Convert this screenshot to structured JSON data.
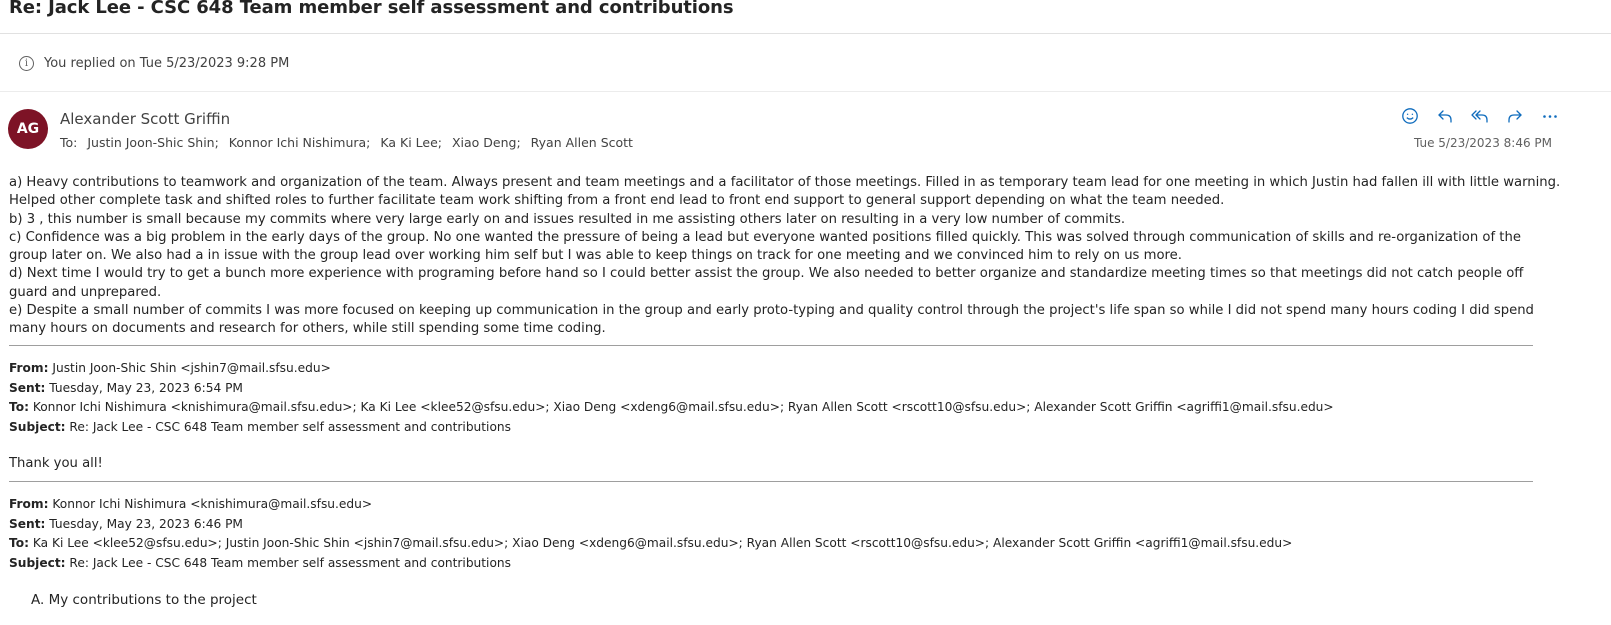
{
  "subject": "Re: Jack Lee - CSC 648 Team member self assessment and contributions",
  "info": {
    "icon": "info-icon",
    "text": "You replied on Tue 5/23/2023 9:28 PM"
  },
  "message": {
    "avatar_initials": "AG",
    "avatar_color": "#7d1326",
    "sender": "Alexander Scott Griffin",
    "to_label": "To:",
    "recipients": [
      "Justin Joon-Shic Shin;",
      "Konnor Ichi Nishimura;",
      "Ka Ki Lee;",
      "Xiao Deng;",
      "Ryan Allen Scott"
    ],
    "date": "Tue 5/23/2023 8:46 PM",
    "actions": [
      {
        "name": "react",
        "icon": "smiley-icon"
      },
      {
        "name": "reply",
        "icon": "reply-icon"
      },
      {
        "name": "reply-all",
        "icon": "reply-all-icon"
      },
      {
        "name": "forward",
        "icon": "forward-icon"
      },
      {
        "name": "more",
        "icon": "more-icon"
      }
    ],
    "accent_color": "#0f6cbd",
    "body": [
      "a) Heavy contributions to teamwork and organization of the team. Always present and team meetings and a facilitator of those meetings. Filled in as temporary team lead for one meeting in which Justin had fallen ill with little warning. Helped other complete task and shifted roles to further facilitate team work shifting from a front end lead to front end support to general support depending on what the team needed.",
      "b) 3 , this number is small because my commits where very large early on and issues resulted in me assisting others later on resulting in a very low number of commits.",
      "c) Confidence was a big problem in the early days of the group. No one wanted the pressure of being a lead but everyone wanted positions filled quickly. This was solved through communication of skills and re-organization of the group later on. We also had a in issue with the group lead over working him self but I was able to keep things on track for one meeting and we convinced him to rely on us more.",
      "d) Next time I would try to get a bunch more experience with programing before hand so I could better assist the group. We also needed to better organize and standardize meeting times so that meetings did not catch people off guard and unprepared.",
      "e) Despite a small number of commits I was more focused on keeping up communication in the group and early proto-typing and quality control through the project's life span so while I did not spend many hours coding I did spend many hours on documents and research for others, while still spending some time coding."
    ]
  },
  "quoted": [
    {
      "from_label": "From:",
      "from": "Justin Joon-Shic Shin <jshin7@mail.sfsu.edu>",
      "sent_label": "Sent:",
      "sent": "Tuesday, May 23, 2023 6:54 PM",
      "to_label": "To:",
      "to": "Konnor Ichi Nishimura <knishimura@mail.sfsu.edu>; Ka Ki Lee <klee52@sfsu.edu>; Xiao Deng <xdeng6@mail.sfsu.edu>; Ryan Allen Scott <rscott10@sfsu.edu>; Alexander Scott Griffin <agriffi1@mail.sfsu.edu>",
      "subject_label": "Subject:",
      "subject": "Re: Jack Lee - CSC 648 Team member self assessment and contributions",
      "body": "Thank you all!"
    },
    {
      "from_label": "From:",
      "from": "Konnor Ichi Nishimura <knishimura@mail.sfsu.edu>",
      "sent_label": "Sent:",
      "sent": "Tuesday, May 23, 2023 6:46 PM",
      "to_label": "To:",
      "to": "Ka Ki Lee <klee52@sfsu.edu>; Justin Joon-Shic Shin <jshin7@mail.sfsu.edu>; Xiao Deng <xdeng6@mail.sfsu.edu>; Ryan Allen Scott <rscott10@sfsu.edu>; Alexander Scott Griffin <agriffi1@mail.sfsu.edu>",
      "subject_label": "Subject:",
      "subject": "Re: Jack Lee - CSC 648 Team member self assessment and contributions",
      "body": "A. My contributions to the project"
    }
  ]
}
